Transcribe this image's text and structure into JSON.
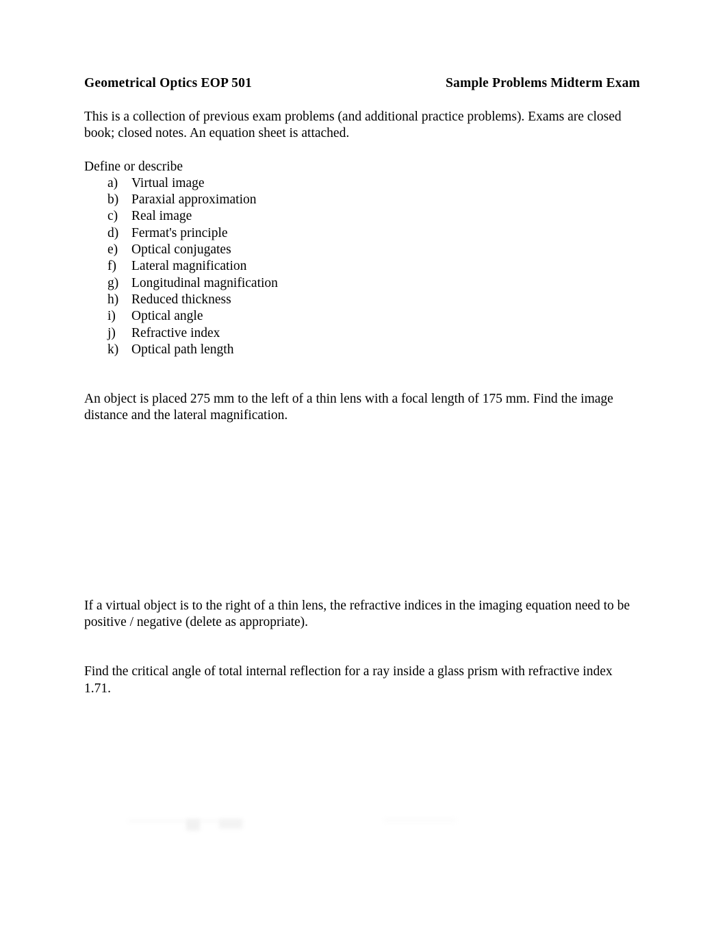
{
  "header": {
    "left_title": "Geometrical Optics EOP 501",
    "right_title": "Sample Problems Midterm Exam"
  },
  "intro": {
    "paragraph": "This is a collection of previous exam problems (and additional practice problems). Exams are closed book; closed notes. An equation sheet is attached."
  },
  "define_section": {
    "prompt": "Define or describe",
    "items": [
      {
        "marker": "a)",
        "label": "Virtual image"
      },
      {
        "marker": "b)",
        "label": "Paraxial approximation"
      },
      {
        "marker": "c)",
        "label": "Real image"
      },
      {
        "marker": "d)",
        "label": "Fermat's principle"
      },
      {
        "marker": "e)",
        "label": "Optical conjugates"
      },
      {
        "marker": "f)",
        "label": "Lateral magnification"
      },
      {
        "marker": "g)",
        "label": "Longitudinal magnification"
      },
      {
        "marker": "h)",
        "label": "Reduced thickness"
      },
      {
        "marker": "i)",
        "label": "Optical angle"
      },
      {
        "marker": "j)",
        "label": "Refractive index"
      },
      {
        "marker": "k)",
        "label": "Optical path length"
      }
    ]
  },
  "problems": [
    {
      "text": "An object is placed 275 mm to the left of a thin lens with a focal length of 175 mm. Find the image distance and the lateral magnification."
    },
    {
      "text": "If a virtual object is to the right of a thin lens, the refractive indices in the imaging equation need to be positive / negative (delete as appropriate)."
    },
    {
      "text": "Find the critical angle of total internal reflection for a ray inside a glass prism with refractive index 1.71."
    }
  ]
}
